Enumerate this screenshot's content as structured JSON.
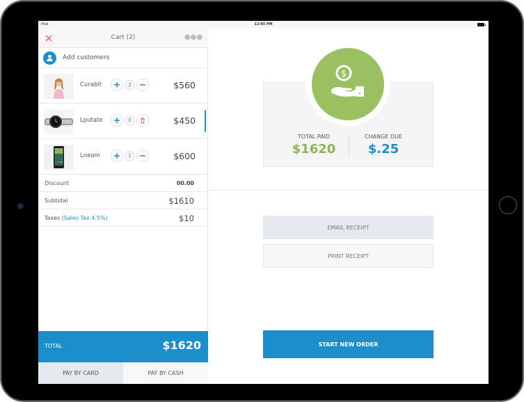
{
  "status_bar": {
    "carrier": "iPad",
    "time": "12:45 PM"
  },
  "cart": {
    "title": "Cart (2)",
    "add_customer_label": "Add customers",
    "items": [
      {
        "name": "Curabit",
        "qty": "2",
        "price": "$560",
        "thumb": "woman-in-pink-top",
        "secondary_action": "minus"
      },
      {
        "name": "Lputate",
        "qty": "0",
        "price": "$450",
        "thumb": "wristwatch",
        "secondary_action": "delete"
      },
      {
        "name": "Lneom",
        "qty": "1",
        "price": "$600",
        "thumb": "smartphone",
        "secondary_action": "minus"
      }
    ],
    "summary": {
      "discount_label": "Discount",
      "discount_value": "00.00",
      "subtotal_label": "Subtotal",
      "subtotal_value": "$1610",
      "taxes_label": "Taxes",
      "taxes_detail": "(Sales Tax 4.5%)",
      "taxes_value": "$10"
    },
    "total_label": "TOTAL",
    "total_value": "$1620",
    "pay_by_card": "PAY BY CARD",
    "pay_by_cash": "PAY BY CASH"
  },
  "payment": {
    "total_paid_label": "TOTAL PAID",
    "total_paid_value": "$1620",
    "change_due_label": "CHANGE DUE",
    "change_due_value": "$.25",
    "email_receipt": "EMAIL RECEIPT",
    "print_receipt": "PRINT RECEIPT",
    "start_new_order": "START NEW ORDER"
  },
  "colors": {
    "accent_blue": "#1b8fcb",
    "success_green": "#9bc062",
    "danger_red": "#e8585a"
  }
}
